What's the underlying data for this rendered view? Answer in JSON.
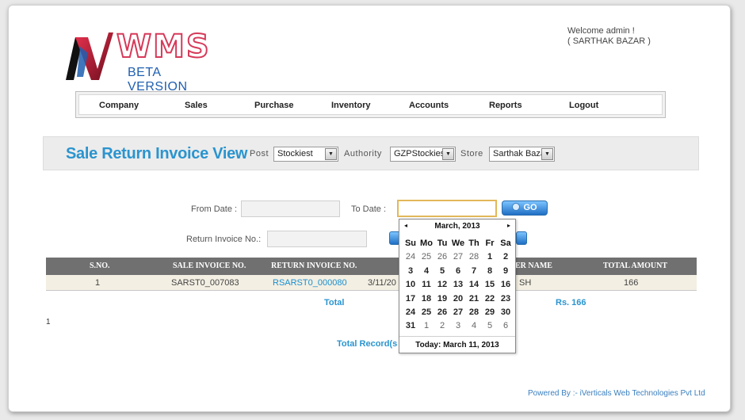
{
  "header": {
    "logo_text": "WMS",
    "logo_subtitle": "BETA VERSION",
    "welcome_line1": "Welcome admin !",
    "welcome_line2": "( SARTHAK BAZAR )"
  },
  "nav": {
    "items": [
      "Company",
      "Sales",
      "Purchase",
      "Inventory",
      "Accounts",
      "Reports",
      "Logout"
    ]
  },
  "titlebar": {
    "title": "Sale Return Invoice View",
    "post_label": "Post",
    "post_value": "Stockiest",
    "authority_label": "Authority",
    "authority_value": "GZPStockies",
    "store_label": "Store",
    "store_value": "Sarthak Baza"
  },
  "filters": {
    "from_label": "From Date :",
    "to_label": "To Date :",
    "return_label": "Return Invoice No.:",
    "go_label": "GO",
    "from_value": "",
    "to_value": "",
    "return_value": ""
  },
  "table": {
    "headers": [
      "S.NO.",
      "SALE INVOICE NO.",
      "RETURN INVOICE NO.",
      "ER NAME",
      "TOTAL AMOUNT"
    ],
    "rows": [
      {
        "sno": "1",
        "sale_invoice": "SARST0_007083",
        "return_invoice": "RSARST0_000080",
        "date": "3/11/20",
        "name": "SH",
        "amount": "166"
      }
    ],
    "total_label": "Total",
    "total_amount": "Rs. 166",
    "page": "1",
    "total_records_label": "Total Record(s"
  },
  "calendar": {
    "month": "March, 2013",
    "prev": "◂",
    "next": "▸",
    "weekdays": [
      "Su",
      "Mo",
      "Tu",
      "We",
      "Th",
      "Fr",
      "Sa"
    ],
    "weeks": [
      [
        "24",
        "25",
        "26",
        "27",
        "28",
        "1",
        "2"
      ],
      [
        "3",
        "4",
        "5",
        "6",
        "7",
        "8",
        "9"
      ],
      [
        "10",
        "11",
        "12",
        "13",
        "14",
        "15",
        "16"
      ],
      [
        "17",
        "18",
        "19",
        "20",
        "21",
        "22",
        "23"
      ],
      [
        "24",
        "25",
        "26",
        "27",
        "28",
        "29",
        "30"
      ],
      [
        "31",
        "1",
        "2",
        "3",
        "4",
        "5",
        "6"
      ]
    ],
    "dim_cells": [
      [
        0,
        0
      ],
      [
        0,
        1
      ],
      [
        0,
        2
      ],
      [
        0,
        3
      ],
      [
        0,
        4
      ],
      [
        5,
        1
      ],
      [
        5,
        2
      ],
      [
        5,
        3
      ],
      [
        5,
        4
      ],
      [
        5,
        5
      ],
      [
        5,
        6
      ]
    ],
    "today": "Today: March 11, 2013"
  },
  "footer": {
    "powered_by": "Powered By :- iVerticals Web Technologies Pvt Ltd"
  },
  "colors": {
    "accent": "#2a94cf",
    "logo_red": "#d63a5a",
    "logo_blue": "#1f5fb0",
    "table_header": "#707070"
  }
}
